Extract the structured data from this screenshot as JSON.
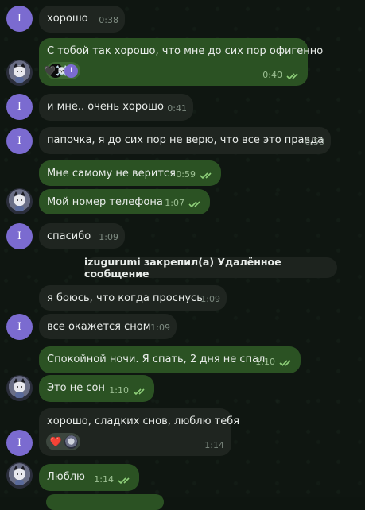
{
  "messages": [
    {
      "text": "хорошо",
      "time": "0:38"
    },
    {
      "text": "С тобой так хорошо, что мне до сих пор офигенно",
      "time": "0:40",
      "reactions": [
        "🖤☠️",
        "I"
      ]
    },
    {
      "text": "и мне.. очень хорошо",
      "time": "0:41"
    },
    {
      "text": "папочка, я до сих пор не верю, что все это правда",
      "time": "0:58"
    },
    {
      "text": "Мне самому не верится",
      "time": "0:59"
    },
    {
      "text": "Мой номер телефона",
      "time": "1:07"
    },
    {
      "text": "спасибо",
      "time": "1:09"
    },
    {
      "text": "я боюсь, что когда проснусь",
      "time": "1:09"
    },
    {
      "text": "все окажется сном",
      "time": "1:09"
    },
    {
      "text": "Спокойной ночи. Я спать, 2 дня не спал.",
      "time": "1:10"
    },
    {
      "text": "Это не сон",
      "time": "1:10"
    },
    {
      "text": "хорошо, сладких снов, люблю тебя",
      "time": "1:14",
      "reactions": [
        "❤️",
        "avatar"
      ]
    },
    {
      "text": "Люблю",
      "time": "1:14"
    }
  ],
  "service": {
    "text": "izugurumi закрепил(а) Удалённое сообщение"
  },
  "avatar_letter": "I",
  "colors": {
    "incoming": "#1f2520",
    "outgoing": "#2b5223",
    "avatar_letter_bg": "#7b6bd0",
    "check": "#8fd07a"
  }
}
